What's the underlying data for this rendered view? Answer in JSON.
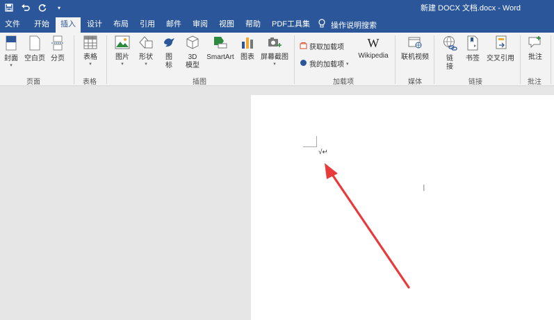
{
  "window": {
    "title": "新建 DOCX 文档.docx - Word"
  },
  "tabs": [
    "文件",
    "开始",
    "插入",
    "设计",
    "布局",
    "引用",
    "邮件",
    "审阅",
    "视图",
    "帮助",
    "PDF工具集"
  ],
  "active_tab": "插入",
  "tell_me": "操作说明搜索",
  "ribbon": {
    "pages": {
      "cover": "封面",
      "blank": "空白页",
      "break": "分页",
      "group": "页面"
    },
    "tables": {
      "table": "表格",
      "group": "表格"
    },
    "illustrations": {
      "pictures": "图片",
      "shapes": "形状",
      "icons_1": "图",
      "icons_2": "标",
      "model_1": "3D",
      "model_2": "模型",
      "smartart": "SmartArt",
      "chart": "图表",
      "screenshot": "屏幕截图",
      "group": "插图"
    },
    "addins": {
      "get": "获取加载项",
      "my": "我的加载项",
      "wikipedia": "Wikipedia",
      "group": "加载项"
    },
    "media": {
      "video": "联机视频",
      "group": "媒体"
    },
    "links": {
      "link_1": "链",
      "link_2": "接",
      "bookmark": "书签",
      "crossref": "交叉引用",
      "group": "链接"
    },
    "comments": {
      "comment": "批注",
      "group": "批注"
    }
  },
  "colors": {
    "brand": "#2b579a",
    "ribbon_bg": "#f3f3f3",
    "arrow": "#e83a3a",
    "workspace": "#e6e6e6"
  },
  "icons": [
    "save-icon",
    "undo-icon",
    "redo-icon",
    "qat-customize-icon",
    "lightbulb-icon"
  ]
}
